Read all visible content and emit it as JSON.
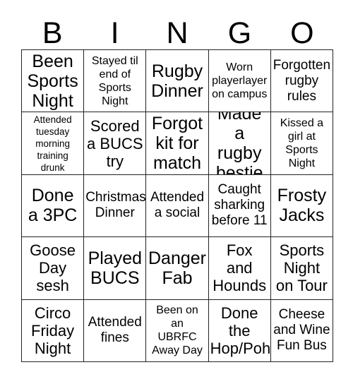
{
  "card": {
    "title": "BINGO",
    "header_letters": [
      "B",
      "I",
      "N",
      "G",
      "O"
    ],
    "columns": 5,
    "rows": 5,
    "colors": {
      "background": "#ffffff",
      "text": "#000000",
      "grid_line": "#222222"
    },
    "cells": [
      {
        "text": "Been\nSports\nNight",
        "size": "xl"
      },
      {
        "text": "Stayed til\nend of\nSports\nNight",
        "size": "sm"
      },
      {
        "text": "Rugby\nDinner",
        "size": "xl"
      },
      {
        "text": "Worn\nplayerlayer\non campus",
        "size": "sm"
      },
      {
        "text": "Forgotten\nrugby\nrules",
        "size": "md"
      },
      {
        "text": "Attended\ntuesday\nmorning\ntraining\ndrunk",
        "size": "xs"
      },
      {
        "text": "Scored\na BUCS\ntry",
        "size": "lg"
      },
      {
        "text": "Forgot\nkit for\nmatch",
        "size": "xl"
      },
      {
        "text": "Made a\nrugby\nbestie",
        "size": "xl"
      },
      {
        "text": "Kissed a\ngirl at\nSports\nNight",
        "size": "sm"
      },
      {
        "text": "Done\na 3PC",
        "size": "xl"
      },
      {
        "text": "Christmas\nDinner",
        "size": "md"
      },
      {
        "text": "Attended\na social",
        "size": "md"
      },
      {
        "text": "Caught\nsharking\nbefore 11",
        "size": "md"
      },
      {
        "text": "Frosty\nJacks",
        "size": "xl"
      },
      {
        "text": "Goose\nDay\nsesh",
        "size": "lg"
      },
      {
        "text": "Played\nBUCS",
        "size": "xl"
      },
      {
        "text": "Danger\nFab",
        "size": "xl"
      },
      {
        "text": "Fox\nand\nHounds",
        "size": "lg"
      },
      {
        "text": "Sports\nNight\non Tour",
        "size": "lg"
      },
      {
        "text": "Circo\nFriday\nNight",
        "size": "lg"
      },
      {
        "text": "Attended\nfines",
        "size": "md"
      },
      {
        "text": "Been on\nan\nUBRFC\nAway Day",
        "size": "sm"
      },
      {
        "text": "Done\nthe\nHop/Poh",
        "size": "lg"
      },
      {
        "text": "Cheese\nand Wine\nFun Bus",
        "size": "md"
      }
    ]
  }
}
